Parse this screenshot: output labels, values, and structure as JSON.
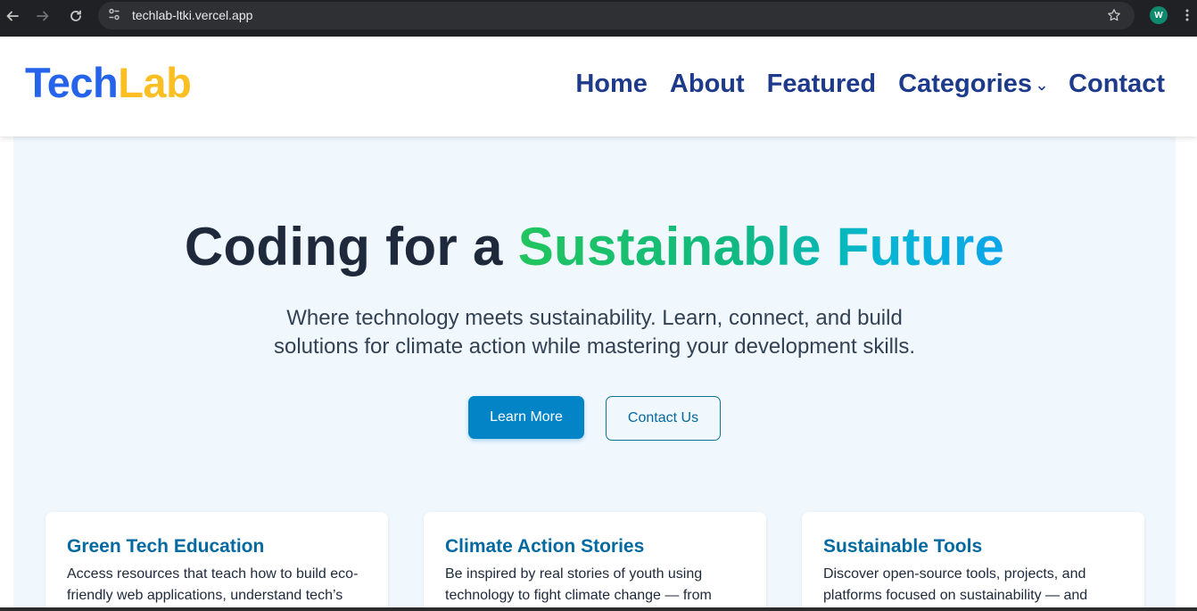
{
  "browser": {
    "url": "techlab-ltki.vercel.app",
    "profile_initial": "W",
    "icons": {
      "back": "back-arrow-icon",
      "forward": "forward-arrow-icon",
      "reload": "reload-icon",
      "site_info": "site-settings-icon",
      "bookmark": "star-icon",
      "menu": "more-vert-icon"
    }
  },
  "header": {
    "logo_part1": "Tech",
    "logo_part2": "Lab",
    "nav": {
      "home": "Home",
      "about": "About",
      "featured": "Featured",
      "categories": "Categories",
      "contact": "Contact"
    }
  },
  "hero": {
    "title_part1": "Coding for a ",
    "title_highlight": "Sustainable Future",
    "subtitle": "Where technology meets sustainability. Learn, connect, and build solutions for climate action while mastering your development skills.",
    "primary_button": "Learn More",
    "secondary_button": "Contact Us"
  },
  "cards": [
    {
      "title": "Green Tech Education",
      "text": "Access resources that teach how to build eco-friendly web applications, understand tech’s"
    },
    {
      "title": "Climate Action Stories",
      "text": "Be inspired by real stories of youth using technology to fight climate change — from"
    },
    {
      "title": "Sustainable Tools",
      "text": "Discover open-source tools, projects, and platforms focused on sustainability — and"
    }
  ],
  "colors": {
    "logo_tech": "#2563eb",
    "logo_lab": "#fbbf24",
    "nav": "#1e3a8a",
    "hero_bg": "#f0f7fd",
    "primary": "#0284c7",
    "card_title": "#0369a1"
  }
}
